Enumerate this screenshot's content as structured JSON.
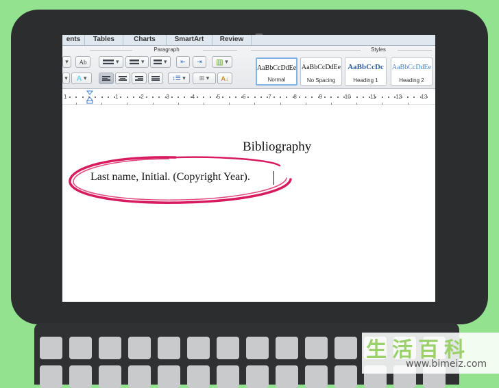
{
  "ribbon": {
    "tabs": [
      "ents",
      "Tables",
      "Charts",
      "SmartArt",
      "Review"
    ],
    "groups": {
      "paragraph": "Paragraph",
      "styles": "Styles"
    },
    "spellcheck_icon_text": "Ab",
    "styles": [
      {
        "sample": "AaBbCcDdEe",
        "name": "Normal"
      },
      {
        "sample": "AaBbCcDdEe",
        "name": "No Spacing"
      },
      {
        "sample": "AaBbCcDc",
        "name": "Heading 1"
      },
      {
        "sample": "AaBbCcDdEe",
        "name": "Heading 2"
      }
    ]
  },
  "ruler": {
    "labels": [
      "1",
      "1",
      "2",
      "3",
      "4",
      "5",
      "6",
      "7",
      "8",
      "9",
      "10",
      "11",
      "12",
      "13"
    ]
  },
  "document": {
    "title": "Bibliography",
    "line1": "Last name, Initial. (Copyright Year)."
  },
  "watermark": {
    "chars": "生活百科",
    "url": "www.bimeiz.com"
  },
  "colors": {
    "background": "#92e28f",
    "laptop": "#2b2d2f",
    "highlight_ellipse": "#d81b60"
  }
}
